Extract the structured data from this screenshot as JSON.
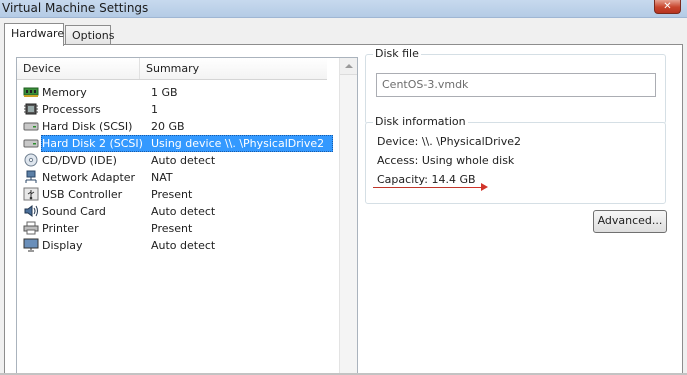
{
  "window": {
    "title": "Virtual Machine Settings",
    "close_glyph": "✕"
  },
  "tabs": [
    {
      "label": "Hardware",
      "active": true
    },
    {
      "label": "Options",
      "active": false
    }
  ],
  "device_list": {
    "columns": [
      "Device",
      "Summary"
    ],
    "rows": [
      {
        "icon": "memory-icon",
        "device": "Memory",
        "summary": "1 GB"
      },
      {
        "icon": "processor-icon",
        "device": "Processors",
        "summary": "1"
      },
      {
        "icon": "hard-disk-icon",
        "device": "Hard Disk (SCSI)",
        "summary": "20 GB"
      },
      {
        "icon": "hard-disk-icon",
        "device": "Hard Disk 2 (SCSI)",
        "summary": "Using device \\\\. \\PhysicalDrive2",
        "selected": true
      },
      {
        "icon": "cd-dvd-icon",
        "device": "CD/DVD (IDE)",
        "summary": "Auto detect"
      },
      {
        "icon": "network-adapter-icon",
        "device": "Network Adapter",
        "summary": "NAT"
      },
      {
        "icon": "usb-controller-icon",
        "device": "USB Controller",
        "summary": "Present"
      },
      {
        "icon": "sound-card-icon",
        "device": "Sound Card",
        "summary": "Auto detect"
      },
      {
        "icon": "printer-icon",
        "device": "Printer",
        "summary": "Present"
      },
      {
        "icon": "display-icon",
        "device": "Display",
        "summary": "Auto detect"
      }
    ]
  },
  "disk_file": {
    "legend": "Disk file",
    "value": "CentOS-3.vmdk"
  },
  "disk_information": {
    "legend": "Disk information",
    "device": "Device:  \\\\. \\PhysicalDrive2",
    "access": "Access:  Using whole disk",
    "capacity": "Capacity:  14.4 GB"
  },
  "buttons": {
    "advanced": "Advanced..."
  },
  "colors": {
    "selection": "#3399ff",
    "annotation_red": "#d1342a",
    "title_bar": "#b4cbe5"
  }
}
